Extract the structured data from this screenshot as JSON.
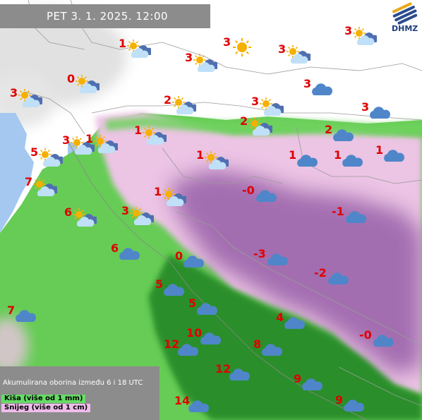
{
  "header": {
    "text": "PET   3. 1. 2025. 12:00"
  },
  "logo": {
    "text": "DHMZ"
  },
  "legend": {
    "title": "Akumulirana oborina između 6 i 18 UTC",
    "rain": "Kiša (više od 1 mm)",
    "snow": "Snijeg (više od 1 cm)"
  },
  "colors": {
    "rain": "#66dd66",
    "rain_heavy": "#1f8a1f",
    "snow": "#ecc4e4",
    "snow_heavy": "#9c5ea8",
    "sea": "#a4c8f0",
    "temp": "#e00000",
    "cloud": "#4f86c9",
    "sun": "#f5b000"
  },
  "stations": [
    {
      "temp": "1",
      "icon": "partly-cloudy"
    },
    {
      "temp": "3",
      "icon": "sun"
    },
    {
      "temp": "3",
      "icon": "partly-cloudy"
    },
    {
      "temp": "3",
      "icon": "partly-cloudy"
    },
    {
      "temp": "3",
      "icon": "partly-cloudy"
    },
    {
      "temp": "0",
      "icon": "partly-cloudy"
    },
    {
      "temp": "3",
      "icon": "cloud"
    },
    {
      "temp": "3",
      "icon": "partly-cloudy"
    },
    {
      "temp": "2",
      "icon": "partly-cloudy"
    },
    {
      "temp": "3",
      "icon": "partly-cloudy"
    },
    {
      "temp": "3",
      "icon": "cloud"
    },
    {
      "temp": "2",
      "icon": "partly-cloudy"
    },
    {
      "temp": "2",
      "icon": "cloud"
    },
    {
      "temp": "1",
      "icon": "partly-cloudy"
    },
    {
      "temp": "3",
      "icon": "partly-cloudy"
    },
    {
      "temp": "1",
      "icon": "partly-cloudy"
    },
    {
      "temp": "5",
      "icon": "partly-cloudy"
    },
    {
      "temp": "1",
      "icon": "partly-cloudy"
    },
    {
      "temp": "1",
      "icon": "cloud"
    },
    {
      "temp": "1",
      "icon": "cloud"
    },
    {
      "temp": "1",
      "icon": "cloud"
    },
    {
      "temp": "7",
      "icon": "partly-cloudy"
    },
    {
      "temp": "1",
      "icon": "partly-cloudy"
    },
    {
      "temp": "-0",
      "icon": "cloud"
    },
    {
      "temp": "6",
      "icon": "partly-cloudy"
    },
    {
      "temp": "3",
      "icon": "partly-cloudy"
    },
    {
      "temp": "-1",
      "icon": "cloud"
    },
    {
      "temp": "6",
      "icon": "cloud"
    },
    {
      "temp": "0",
      "icon": "cloud"
    },
    {
      "temp": "-3",
      "icon": "cloud"
    },
    {
      "temp": "-2",
      "icon": "cloud"
    },
    {
      "temp": "5",
      "icon": "cloud"
    },
    {
      "temp": "5",
      "icon": "cloud"
    },
    {
      "temp": "7",
      "icon": "cloud"
    },
    {
      "temp": "4",
      "icon": "cloud"
    },
    {
      "temp": "-0",
      "icon": "cloud"
    },
    {
      "temp": "10",
      "icon": "cloud"
    },
    {
      "temp": "12",
      "icon": "cloud"
    },
    {
      "temp": "8",
      "icon": "cloud"
    },
    {
      "temp": "12",
      "icon": "cloud"
    },
    {
      "temp": "9",
      "icon": "cloud"
    },
    {
      "temp": "14",
      "icon": "cloud"
    },
    {
      "temp": "9",
      "icon": "cloud"
    }
  ]
}
